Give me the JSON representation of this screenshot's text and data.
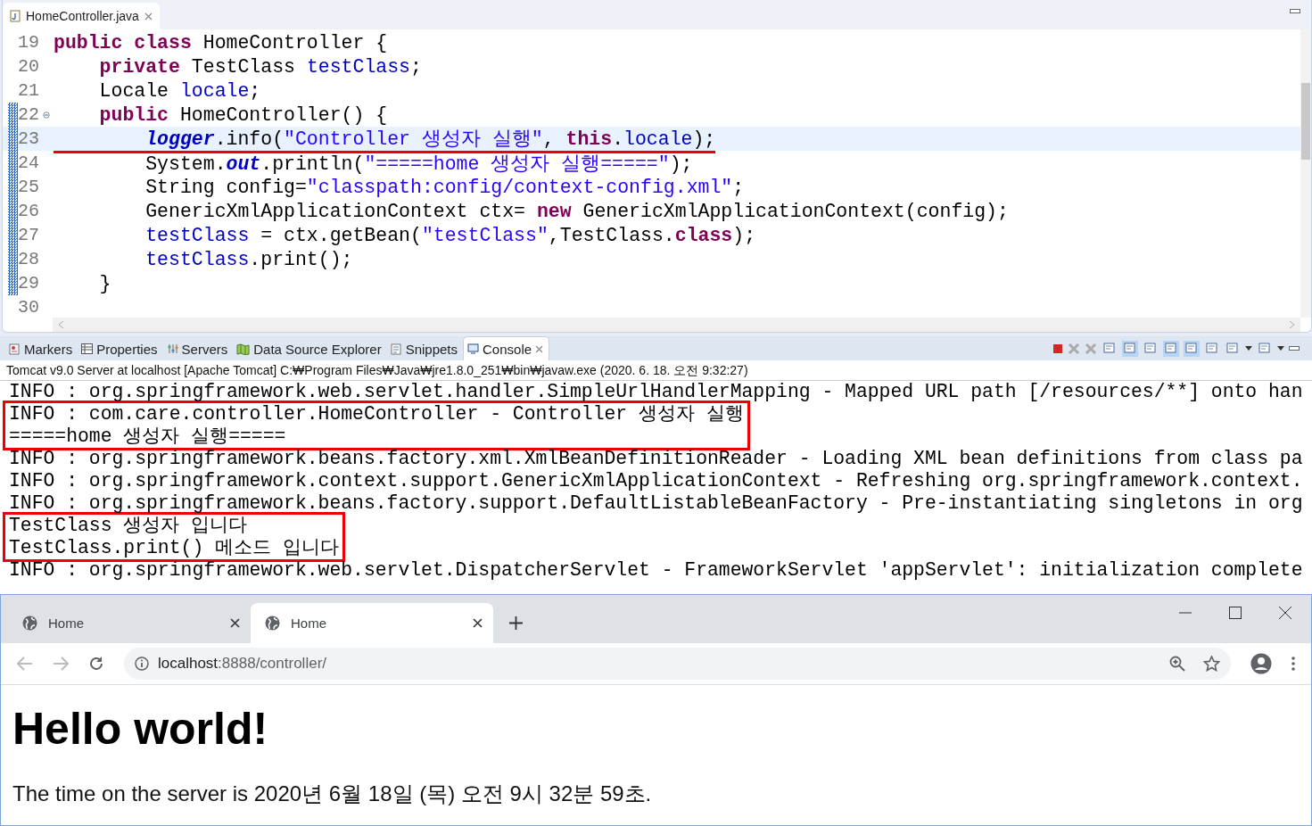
{
  "editor": {
    "tab": {
      "label": "HomeController.java",
      "selected": true
    },
    "lines": [
      {
        "number": "19",
        "tokens": [
          {
            "kind": "keyword",
            "text": "public class"
          },
          {
            "kind": "plain",
            "text": " HomeController {"
          }
        ]
      },
      {
        "number": "20",
        "tokens": [
          {
            "kind": "keyword",
            "text": "    private"
          },
          {
            "kind": "plain",
            "text": " TestClass "
          },
          {
            "kind": "field",
            "text": "testClass"
          },
          {
            "kind": "plain",
            "text": ";"
          }
        ]
      },
      {
        "number": "21",
        "tokens": [
          {
            "kind": "plain",
            "text": "    Locale "
          },
          {
            "kind": "field",
            "text": "locale"
          },
          {
            "kind": "plain",
            "text": ";"
          }
        ]
      },
      {
        "number": "22",
        "fold": true,
        "changed": true,
        "tokens": [
          {
            "kind": "keyword",
            "text": "    public"
          },
          {
            "kind": "plain",
            "text": " HomeController() {"
          }
        ]
      },
      {
        "number": "23",
        "changed": true,
        "current": true,
        "underlined": true,
        "tokens": [
          {
            "kind": "static",
            "text": "        logger"
          },
          {
            "kind": "plain",
            "text": ".info("
          },
          {
            "kind": "string",
            "text": "\"Controller 생성자 실행\""
          },
          {
            "kind": "plain",
            "text": ", "
          },
          {
            "kind": "keyword",
            "text": "this"
          },
          {
            "kind": "plain",
            "text": "."
          },
          {
            "kind": "field",
            "text": "locale"
          },
          {
            "kind": "plain",
            "text": ");"
          }
        ]
      },
      {
        "number": "24",
        "changed": true,
        "tokens": [
          {
            "kind": "plain",
            "text": "        System."
          },
          {
            "kind": "static",
            "text": "out"
          },
          {
            "kind": "plain",
            "text": ".println("
          },
          {
            "kind": "string",
            "text": "\"=====home 생성자 실행=====\""
          },
          {
            "kind": "plain",
            "text": ");"
          }
        ]
      },
      {
        "number": "25",
        "changed": true,
        "tokens": [
          {
            "kind": "plain",
            "text": "        String config="
          },
          {
            "kind": "string",
            "text": "\"classpath:config/context-config.xml\""
          },
          {
            "kind": "plain",
            "text": ";"
          }
        ]
      },
      {
        "number": "26",
        "changed": true,
        "tokens": [
          {
            "kind": "plain",
            "text": "        GenericXmlApplicationContext ctx= "
          },
          {
            "kind": "keyword",
            "text": "new"
          },
          {
            "kind": "plain",
            "text": " GenericXmlApplicationContext(config);"
          }
        ]
      },
      {
        "number": "27",
        "changed": true,
        "tokens": [
          {
            "kind": "field",
            "text": "        testClass"
          },
          {
            "kind": "plain",
            "text": " = ctx.getBean("
          },
          {
            "kind": "string",
            "text": "\"testClass\""
          },
          {
            "kind": "plain",
            "text": ",TestClass."
          },
          {
            "kind": "keyword",
            "text": "class"
          },
          {
            "kind": "plain",
            "text": ");"
          }
        ]
      },
      {
        "number": "28",
        "changed": true,
        "tokens": [
          {
            "kind": "field",
            "text": "        testClass"
          },
          {
            "kind": "plain",
            "text": ".print();"
          }
        ]
      },
      {
        "number": "29",
        "changed": true,
        "tokens": [
          {
            "kind": "plain",
            "text": "    }"
          }
        ]
      },
      {
        "number": "30"
      }
    ]
  },
  "views": {
    "tabs": [
      {
        "label": "Markers",
        "selected": false
      },
      {
        "label": "Properties",
        "selected": false
      },
      {
        "label": "Servers",
        "selected": false
      },
      {
        "label": "Data Source Explorer",
        "selected": false
      },
      {
        "label": "Snippets",
        "selected": false
      },
      {
        "label": "Console",
        "selected": true
      }
    ],
    "console": {
      "header": "Tomcat v9.0 Server at localhost [Apache Tomcat] C:₩Program Files₩Java₩jre1.8.0_251₩bin₩javaw.exe  (2020. 6. 18. 오전 9:32:27)",
      "groups": [
        {
          "lines": [
            "INFO : org.springframework.web.servlet.handler.SimpleUrlHandlerMapping - Mapped URL path [/resources/**] onto han"
          ]
        },
        {
          "boxed": true,
          "lines": [
            "INFO : com.care.controller.HomeController - Controller 생성자 실행",
            "=====home 생성자 실행====="
          ]
        },
        {
          "lines": [
            "INFO : org.springframework.beans.factory.xml.XmlBeanDefinitionReader - Loading XML bean definitions from class pa",
            "INFO : org.springframework.context.support.GenericXmlApplicationContext - Refreshing org.springframework.context.",
            "INFO : org.springframework.beans.factory.support.DefaultListableBeanFactory - Pre-instantiating singletons in org"
          ]
        },
        {
          "boxed": true,
          "lines": [
            "TestClass 생성자 입니다",
            "TestClass.print() 메소드 입니다"
          ]
        },
        {
          "lines": [
            "INFO : org.springframework.web.servlet.DispatcherServlet - FrameworkServlet 'appServlet': initialization complete"
          ]
        }
      ]
    }
  },
  "browser": {
    "tabs": [
      {
        "label": "Home",
        "selected": false
      },
      {
        "label": "Home",
        "selected": true
      }
    ],
    "address": {
      "host": "localhost",
      "path": ":8888/controller/"
    },
    "heading": "Hello world!",
    "paragraph": "The time on the server is 2020년 6월 18일 (목) 오전 9시 32분 59초."
  }
}
